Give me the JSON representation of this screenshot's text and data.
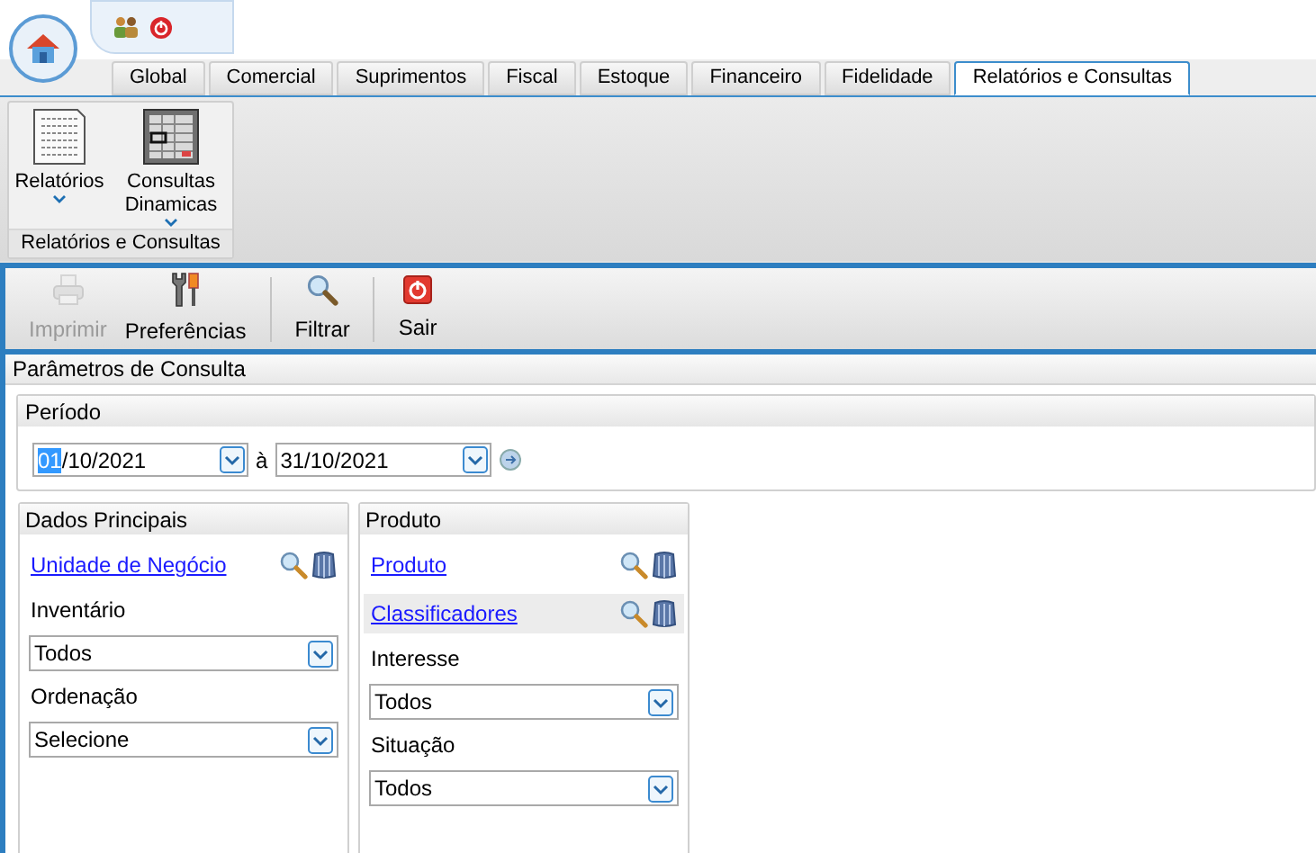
{
  "tabs": [
    {
      "label": "Global",
      "selected": false
    },
    {
      "label": "Comercial",
      "selected": false
    },
    {
      "label": "Suprimentos",
      "selected": false
    },
    {
      "label": "Fiscal",
      "selected": false
    },
    {
      "label": "Estoque",
      "selected": false
    },
    {
      "label": "Financeiro",
      "selected": false
    },
    {
      "label": "Fidelidade",
      "selected": false
    },
    {
      "label": "Relatórios e Consultas",
      "selected": true
    }
  ],
  "ribbon_group": {
    "title": "Relatórios e Consultas",
    "items": [
      {
        "kind": "report",
        "label": "Relatórios"
      },
      {
        "kind": "grid",
        "label": "Consultas Dinamicas"
      }
    ]
  },
  "toolbar": [
    {
      "kind": "print",
      "label": "Imprimir",
      "disabled": true
    },
    {
      "kind": "tools",
      "label": "Preferências",
      "disabled": false
    },
    {
      "kind": "search",
      "label": "Filtrar",
      "disabled": false
    },
    {
      "kind": "exit",
      "label": "Sair",
      "disabled": false
    }
  ],
  "panel_title": "Parâmetros de Consulta",
  "period": {
    "title": "Período",
    "from": {
      "highlighted": "01",
      "rest": "/10/2021"
    },
    "separator": "à",
    "to": {
      "rest": "31/10/2021"
    }
  },
  "groups": [
    {
      "title": "Dados Principais",
      "fields": [
        {
          "kind": "lookup",
          "label": "Unidade de Negócio",
          "shaded": false
        },
        {
          "kind": "select",
          "label": "Inventário",
          "value": "Todos"
        },
        {
          "kind": "select",
          "label": "Ordenação",
          "value": "Selecione"
        }
      ]
    },
    {
      "title": "Produto",
      "fields": [
        {
          "kind": "lookup",
          "label": "Produto",
          "shaded": false
        },
        {
          "kind": "lookup",
          "label": "Classificadores",
          "shaded": true
        },
        {
          "kind": "select",
          "label": "Interesse",
          "value": "Todos"
        },
        {
          "kind": "select",
          "label": "Situação",
          "value": "Todos"
        }
      ]
    }
  ]
}
